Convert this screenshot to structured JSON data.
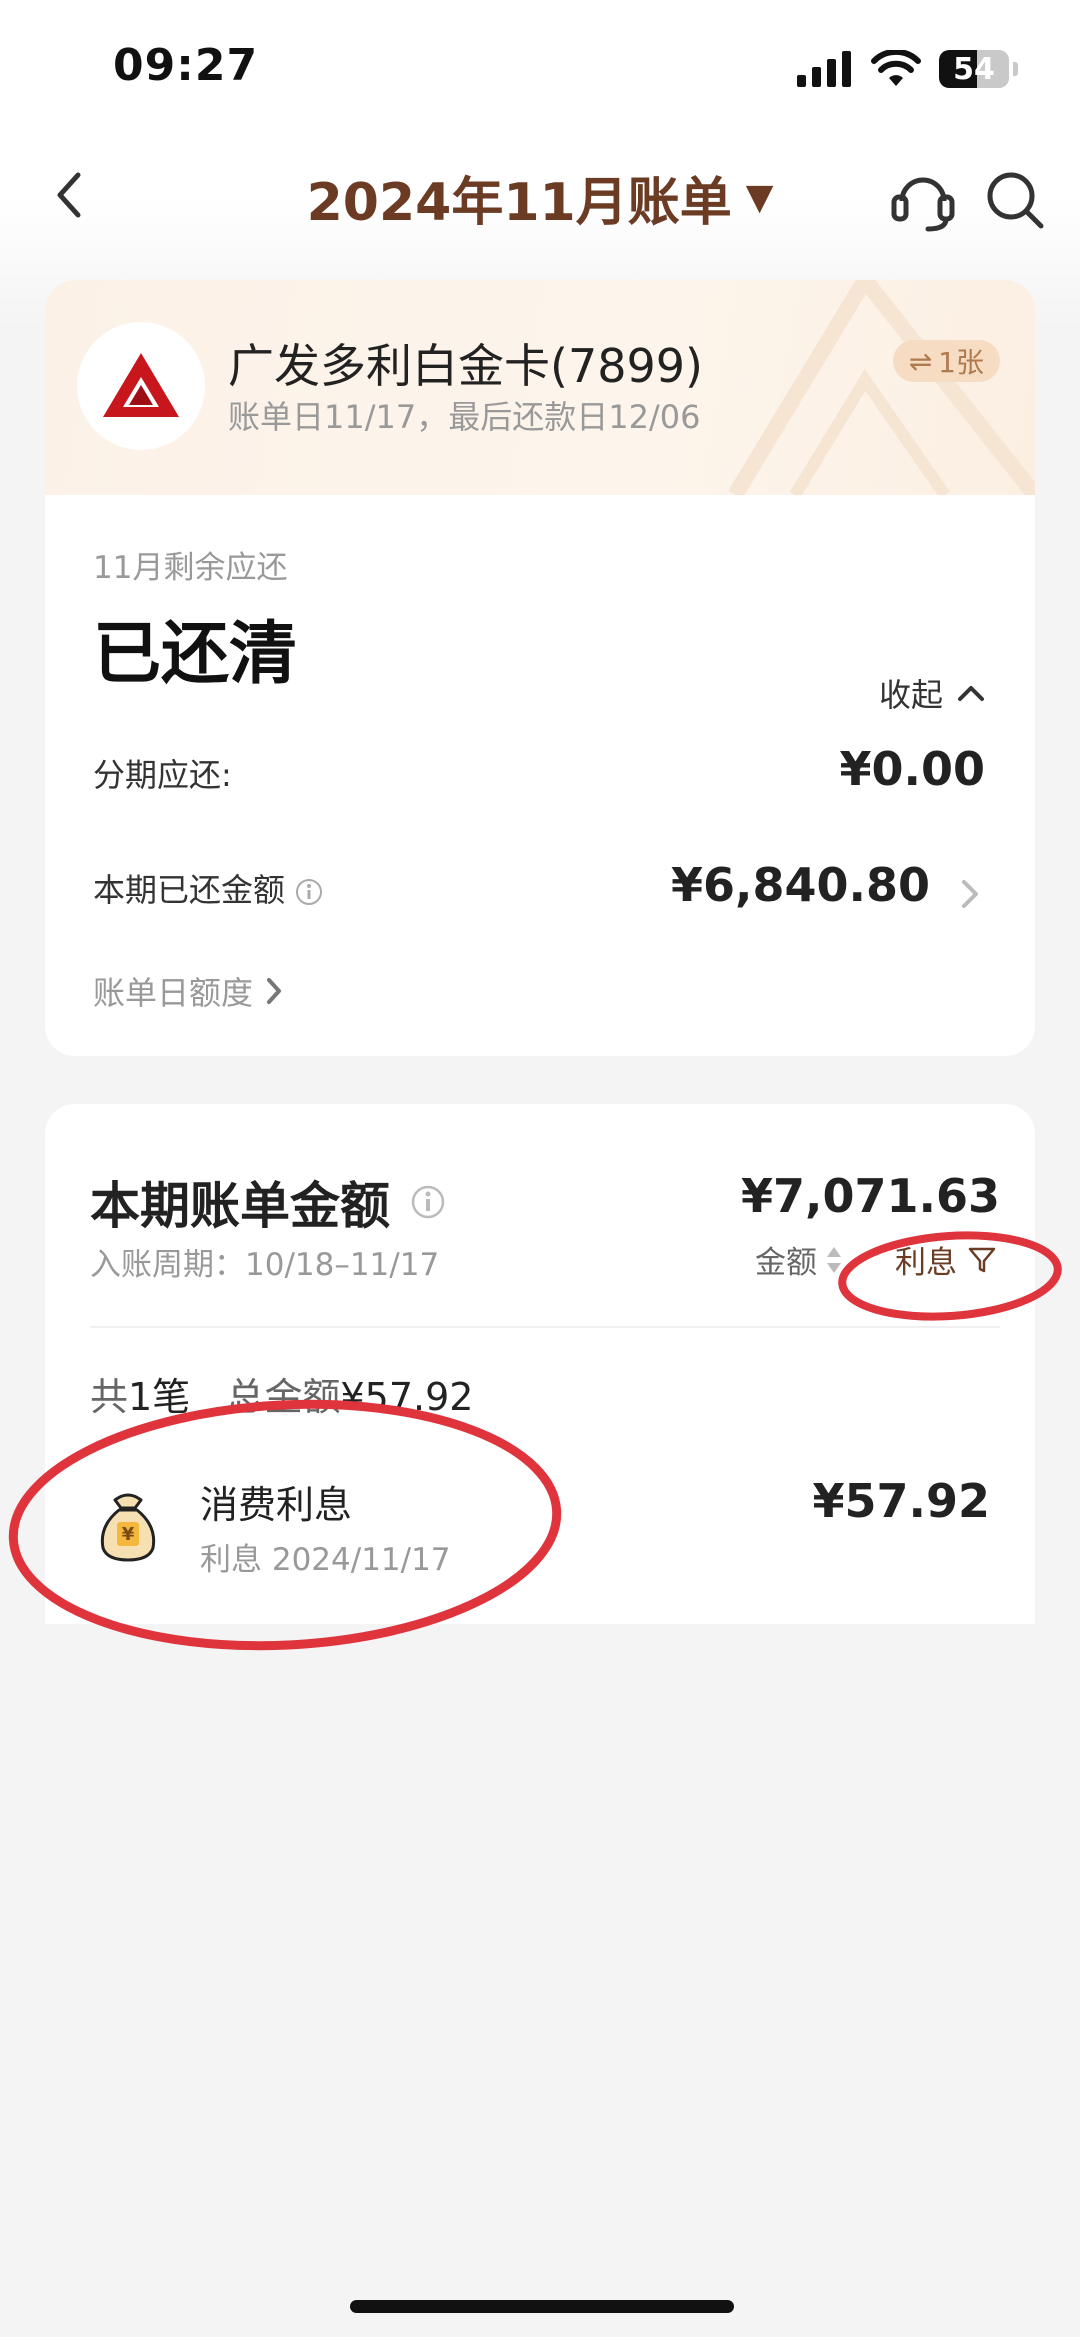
{
  "status_bar": {
    "time": "09:27",
    "battery": "54",
    "battery_level": 0.54
  },
  "nav": {
    "title": "2024年11月账单",
    "title_arrow": "▼",
    "back_icon": "chevron-left-icon",
    "support_icon": "headset-icon",
    "search_icon": "search-icon"
  },
  "card": {
    "name": "广发多利白金卡(7899)",
    "dates": "账单日11/17，最后还款日12/06",
    "switch_badge": "1张",
    "remain_label": "11月剩余应还",
    "remain_value": "已还清",
    "collapse_label": "收起",
    "installment_label": "分期应还:",
    "installment_value": "¥0.00",
    "paid_label": "本期已还金额",
    "paid_value": "¥6,840.80",
    "quota_label": "账单日额度",
    "brand_color": "#c8161d"
  },
  "bill": {
    "title": "本期账单金额",
    "amount": "¥7,071.63",
    "period": "入账周期：10/18–11/17",
    "sort_label": "金额",
    "filter_label": "利息",
    "summary_count_prefix": "共",
    "summary_count": "1笔",
    "summary_total_label": "总金额",
    "summary_total": "¥57.92",
    "transactions": [
      {
        "title": "消费利息",
        "subtitle": "利息 2024/11/17",
        "amount": "¥57.92",
        "icon": "money-bag-icon"
      }
    ]
  },
  "colors": {
    "accent": "#6b3b24",
    "annotation": "#e0343d"
  }
}
